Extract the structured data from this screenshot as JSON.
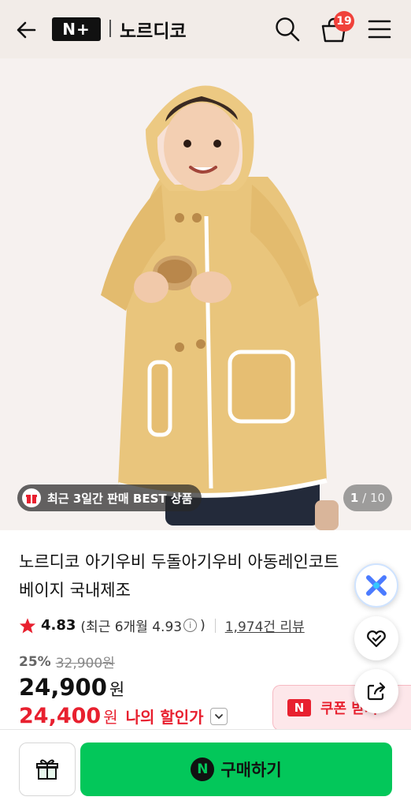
{
  "header": {
    "logo_text": "N+",
    "brand_name": "노르디코",
    "cart_count": "19"
  },
  "gallery": {
    "best_tag": "최근 3일간 판매 BEST 상품",
    "current": "1",
    "total": "/ 10"
  },
  "product": {
    "title_line1": "노르디코 아기우비 두돌아기우비 아동레인코트",
    "title_line2": "베이지 국내제조",
    "rating": "4.83",
    "recent_rating": "(최근 6개월 4.93",
    "recent_close": ")",
    "review_count": "1,974건 리뷰",
    "discount": "25%",
    "original_price": "32,900원",
    "price": "24,900",
    "price_unit": "원",
    "my_price": "24,400",
    "my_price_unit": "원",
    "my_price_label": "나의 할인가",
    "coupon_label": "쿠폰 받기"
  },
  "bottom": {
    "buy_label": "구매하기"
  },
  "colors": {
    "accent_red": "#e8202f",
    "naver_green": "#03c75a",
    "header_bg": "#f2ece8",
    "coat_yellow": "#e9c57c"
  }
}
